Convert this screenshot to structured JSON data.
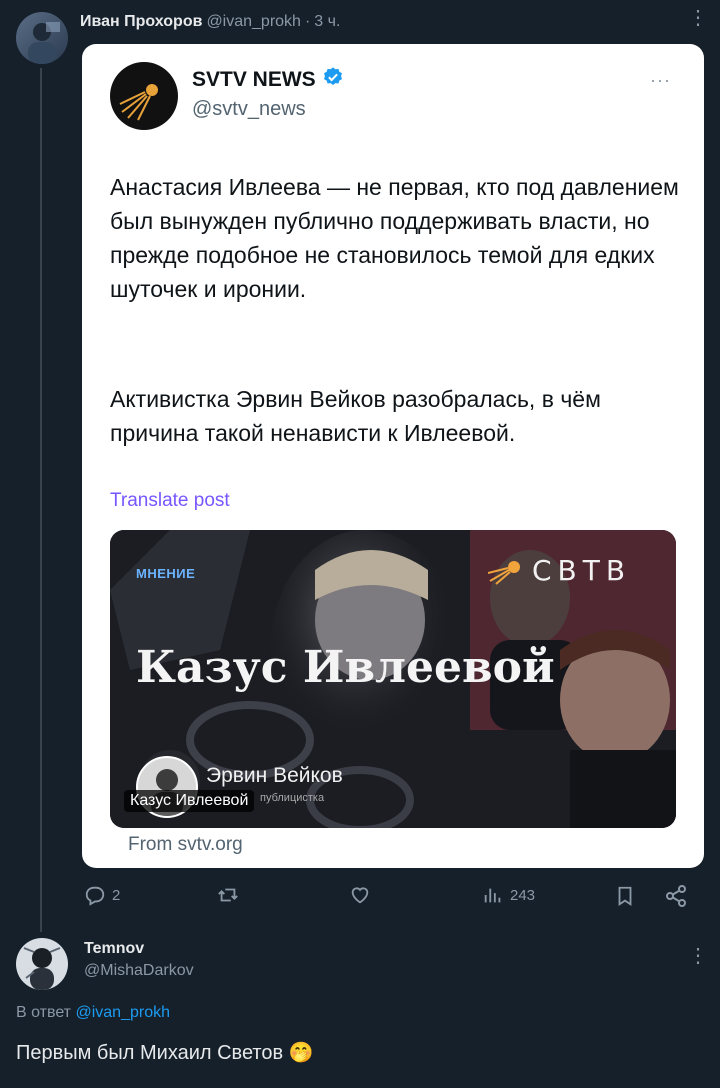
{
  "tweet": {
    "author_name": "Иван Прохоров",
    "handle": "@ivan_prokh",
    "separator": "·",
    "time": "3 ч."
  },
  "quoted": {
    "name": "SVTV NEWS",
    "handle": "@svtv_news",
    "more": "···",
    "text_p1": "Анастасия Ивлеева — не первая, кто под давлением был вынужден публично поддерживать власти, но прежде подобное не становилось темой для едких шуточек и иронии.",
    "text_p2": "Активистка Эрвин Вейков разобралась, в чём причина такой ненависти к Ивлеевой.",
    "translate": "Translate post",
    "card": {
      "tag": "МНЕНИЕ",
      "brand": "СВТВ",
      "headline": "Казус Ивлеевой",
      "author": "Эрвин Вейков",
      "author_role": "публицистка",
      "caption": "Казус Ивлеевой"
    },
    "source": "From svtv.org"
  },
  "actions": {
    "replies": "2",
    "views": "243"
  },
  "reply": {
    "name": "Temnov",
    "handle": "@MishaDarkov",
    "in_reply_prefix": "В ответ",
    "in_reply_handle": "@ivan_prokh",
    "text": "Первым был Михаил Светов",
    "emoji": "🤭"
  },
  "colors": {
    "background": "#15202b",
    "link": "#1d9bf0",
    "translate": "#7856ff",
    "verified": "#1d9bf0",
    "card_tag": "#6bb3ff"
  },
  "icons": [
    "reply-icon",
    "retweet-icon",
    "like-icon",
    "views-icon",
    "bookmark-icon",
    "share-icon",
    "verified-badge-icon",
    "sputnik-logo-icon"
  ]
}
